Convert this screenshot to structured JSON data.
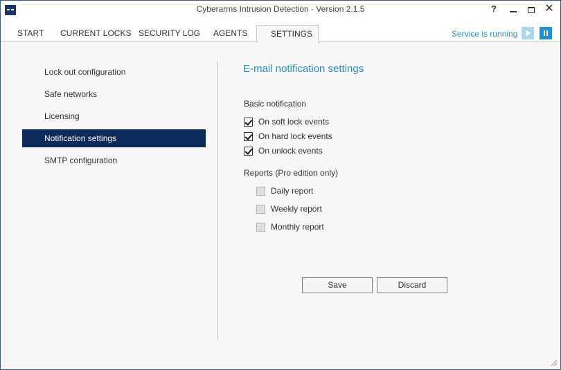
{
  "window": {
    "title": "Cyberarms Intrusion Detection - Version 2.1.5",
    "help_label": "?",
    "close_label": "✕"
  },
  "tabs": [
    {
      "label": "START"
    },
    {
      "label": "CURRENT LOCKS"
    },
    {
      "label": "SECURITY LOG"
    },
    {
      "label": "AGENTS"
    },
    {
      "label": "SETTINGS",
      "active": true
    }
  ],
  "service": {
    "status": "Service is running"
  },
  "nav": {
    "items": [
      {
        "label": "Lock out configuration"
      },
      {
        "label": "Safe networks"
      },
      {
        "label": "Licensing"
      },
      {
        "label": "Notification settings",
        "selected": true
      },
      {
        "label": "SMTP configuration"
      }
    ]
  },
  "content": {
    "title": "E-mail notification settings",
    "basic": {
      "label": "Basic notification",
      "options": [
        {
          "label": "On soft lock events",
          "checked": true
        },
        {
          "label": "On hard lock events",
          "checked": true
        },
        {
          "label": "On unlock events",
          "checked": true
        }
      ]
    },
    "reports": {
      "label": "Reports (Pro edition only)",
      "options": [
        {
          "label": "Daily report",
          "checked": false,
          "disabled": true
        },
        {
          "label": "Weekly report",
          "checked": false,
          "disabled": true
        },
        {
          "label": "Monthly report",
          "checked": false,
          "disabled": true
        }
      ]
    },
    "save_label": "Save",
    "discard_label": "Discard"
  },
  "colors": {
    "accent": "#2a8fc9",
    "nav_selected": "#0e2b5c",
    "app_icon": "#1b3566"
  }
}
